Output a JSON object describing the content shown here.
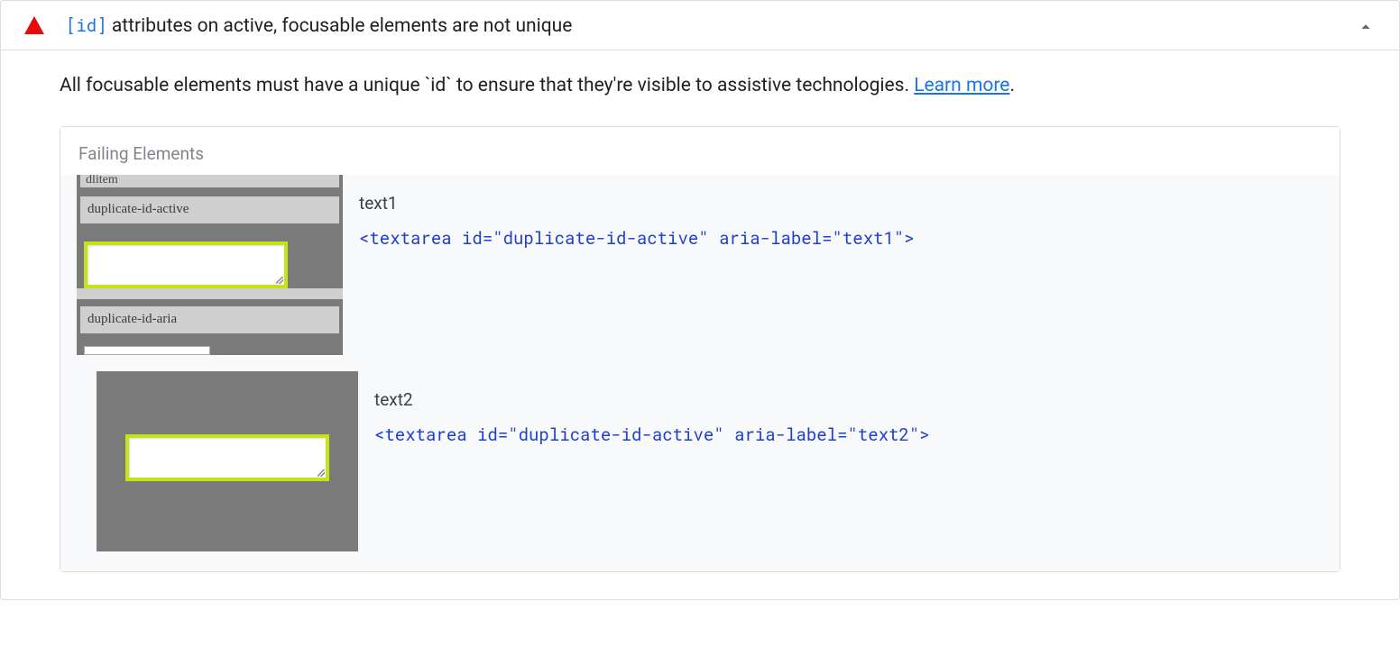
{
  "audit": {
    "title_code": "[id]",
    "title_rest": " attributes on active, focusable elements are not unique",
    "description": "All focusable elements must have a unique `id` to ensure that they're visible to assistive technologies. ",
    "learn_more": "Learn more",
    "period": "."
  },
  "panel": {
    "heading": "Failing Elements"
  },
  "items": [
    {
      "label": "text1",
      "code": "<textarea id=\"duplicate-id-active\" aria-label=\"text1\">",
      "thumb": {
        "row0": "dlitem",
        "row1": "duplicate-id-active",
        "row2": "duplicate-id-aria"
      }
    },
    {
      "label": "text2",
      "code": "<textarea id=\"duplicate-id-active\" aria-label=\"text2\">"
    }
  ]
}
